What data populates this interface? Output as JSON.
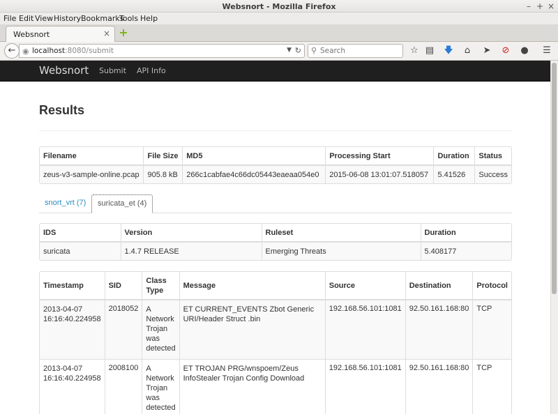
{
  "window": {
    "title": "Websnort - Mozilla Firefox",
    "controls": [
      "–",
      "+",
      "×"
    ]
  },
  "menu": [
    "File",
    "Edit",
    "View",
    "History",
    "Bookmarks",
    "Tools",
    "Help"
  ],
  "tab": {
    "title": "Websnort",
    "close": "×",
    "new_tab": "+"
  },
  "nav": {
    "url_host": "localhost",
    "url_rest": ":8080/submit",
    "search_placeholder": "Search"
  },
  "site": {
    "brand": "Websnort",
    "links": [
      "Submit",
      "API Info"
    ]
  },
  "page": {
    "heading": "Results"
  },
  "file_table": {
    "headers": [
      "Filename",
      "File Size",
      "MD5",
      "Processing Start",
      "Duration",
      "Status"
    ],
    "row": [
      "zeus-v3-sample-online.pcap",
      "905.8 kB",
      "266c1cabfae4c66dc05443eaeaa054e0",
      "2015-06-08 13:01:07.518057",
      "5.41526",
      "Success"
    ]
  },
  "ids_tabs": [
    "snort_vrt (7)",
    "suricata_et (4)"
  ],
  "ids_table": {
    "headers": [
      "IDS",
      "Version",
      "Ruleset",
      "Duration"
    ],
    "row": [
      "suricata",
      "1.4.7 RELEASE",
      "Emerging Threats",
      "5.408177"
    ]
  },
  "alerts_table": {
    "headers": [
      "Timestamp",
      "SID",
      "Class Type",
      "Message",
      "Source",
      "Destination",
      "Protocol"
    ],
    "rows": [
      [
        "2013-04-07 16:16:40.224958",
        "2018052",
        "A Network Trojan was detected",
        "ET CURRENT_EVENTS Zbot Generic URI/Header Struct .bin",
        "192.168.56.101:1081",
        "92.50.161.168:80",
        "TCP"
      ],
      [
        "2013-04-07 16:16:40.224958",
        "2008100",
        "A Network Trojan was detected",
        "ET TROJAN PRG/wnspoem/Zeus InfoStealer Trojan Config Download",
        "192.168.56.101:1081",
        "92.50.161.168:80",
        "TCP"
      ]
    ]
  },
  "colors": {
    "link": "#2a8ec2",
    "navbar": "#1f1f1f"
  }
}
